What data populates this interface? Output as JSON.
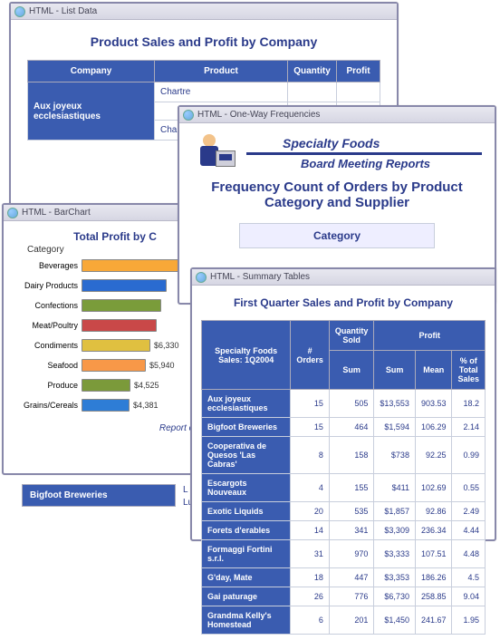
{
  "windows": {
    "listdata": {
      "title": "HTML - List Data",
      "heading": "Product Sales and Profit by Company",
      "cols": [
        "Company",
        "Product",
        "Quantity",
        "Profit"
      ],
      "row1_company": "Aux joyeux ecclesiastiques",
      "row1_product": "Chartre",
      "row2_product": "Chartre"
    },
    "barchart": {
      "title": "HTML - BarChart",
      "heading": "Total Profit by C",
      "axis_label": "Category",
      "footnote": "Report created"
    },
    "freq": {
      "title": "HTML - One-Way Frequencies",
      "brand1": "Specialty Foods",
      "brand2": "Board Meeting Reports",
      "heading": "Frequency Count of Orders by Product Category and Supplier",
      "tab": "Category"
    },
    "summary": {
      "title": "HTML - Summary Tables",
      "heading": "First Quarter Sales and Profit by Company",
      "corner": "Specialty Foods Sales: 1Q2004",
      "cols": {
        "orders": "# Orders",
        "qty": "Quantity Sold",
        "qty_sum": "Sum",
        "profit": "Profit",
        "p_sum": "Sum",
        "p_mean": "Mean",
        "p_pct": "% of Total Sales"
      }
    }
  },
  "stray": {
    "bigfoot": "Bigfoot Breweries",
    "letter1": "L",
    "letter2": "Lu"
  },
  "chart_data": {
    "type": "bar",
    "orientation": "horizontal",
    "title": "Total Profit by Category",
    "xlabel": "",
    "ylabel": "Category",
    "categories": [
      "Beverages",
      "Dairy Products",
      "Confections",
      "Meat/Poultry",
      "Condiments",
      "Seafood",
      "Produce",
      "Grains/Cereals"
    ],
    "values": [
      9200,
      7800,
      7300,
      6900,
      6330,
      5940,
      4525,
      4381
    ],
    "labels": [
      "",
      "",
      "",
      "",
      "$6,330",
      "$5,940",
      "$4,525",
      "$4,381"
    ],
    "series_colors": [
      "#f8a838",
      "#2a6bd0",
      "#7a9c3a",
      "#c94848",
      "#e0c040",
      "#f89848",
      "#7b9a3a",
      "#2e7dd6"
    ],
    "xlim": [
      0,
      10000
    ]
  },
  "summary_rows": [
    {
      "name": "Aux joyeux ecclesiastiques",
      "orders": 15,
      "qty": 505,
      "sum": "$13,553",
      "mean": 903.53,
      "pct": 18.2
    },
    {
      "name": "Bigfoot Breweries",
      "orders": 15,
      "qty": 464,
      "sum": "$1,594",
      "mean": 106.29,
      "pct": 2.14
    },
    {
      "name": "Cooperativa de Quesos 'Las Cabras'",
      "orders": 8,
      "qty": 158,
      "sum": "$738",
      "mean": 92.25,
      "pct": 0.99
    },
    {
      "name": "Escargots Nouveaux",
      "orders": 4,
      "qty": 155,
      "sum": "$411",
      "mean": 102.69,
      "pct": 0.55
    },
    {
      "name": "Exotic Liquids",
      "orders": 20,
      "qty": 535,
      "sum": "$1,857",
      "mean": 92.86,
      "pct": 2.49
    },
    {
      "name": "Forets d'erables",
      "orders": 14,
      "qty": 341,
      "sum": "$3,309",
      "mean": 236.34,
      "pct": 4.44
    },
    {
      "name": "Formaggi Fortini s.r.l.",
      "orders": 31,
      "qty": 970,
      "sum": "$3,333",
      "mean": 107.51,
      "pct": 4.48
    },
    {
      "name": "G'day, Mate",
      "orders": 18,
      "qty": 447,
      "sum": "$3,353",
      "mean": 186.26,
      "pct": 4.5
    },
    {
      "name": "Gai paturage",
      "orders": 26,
      "qty": 776,
      "sum": "$6,730",
      "mean": 258.85,
      "pct": 9.04
    },
    {
      "name": "Grandma Kelly's Homestead",
      "orders": 6,
      "qty": 201,
      "sum": "$1,450",
      "mean": 241.67,
      "pct": 1.95
    }
  ]
}
